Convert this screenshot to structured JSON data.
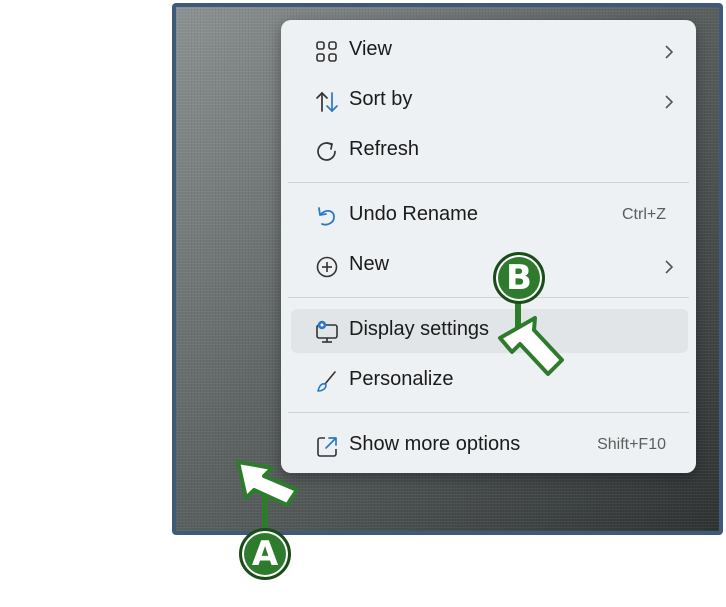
{
  "menu": {
    "items": [
      {
        "label": "View",
        "icon": "grid-icon",
        "submenu": true
      },
      {
        "label": "Sort by",
        "icon": "sort-icon",
        "submenu": true
      },
      {
        "label": "Refresh",
        "icon": "refresh-icon"
      },
      {
        "label": "Undo Rename",
        "icon": "undo-icon",
        "shortcut": "Ctrl+Z"
      },
      {
        "label": "New",
        "icon": "add-circle-icon",
        "submenu": true
      },
      {
        "label": "Display settings",
        "icon": "display-settings-icon",
        "highlighted": true
      },
      {
        "label": "Personalize",
        "icon": "brush-icon"
      },
      {
        "label": "Show more options",
        "icon": "open-external-icon",
        "shortcut": "Shift+F10"
      }
    ]
  },
  "callouts": {
    "a": "A",
    "b": "B"
  },
  "colors": {
    "desktop_border": "#3f5a79",
    "menu_background": "#eef1f3",
    "callout_green": "#2e7b2e",
    "icon_blue": "#2b78c9"
  }
}
